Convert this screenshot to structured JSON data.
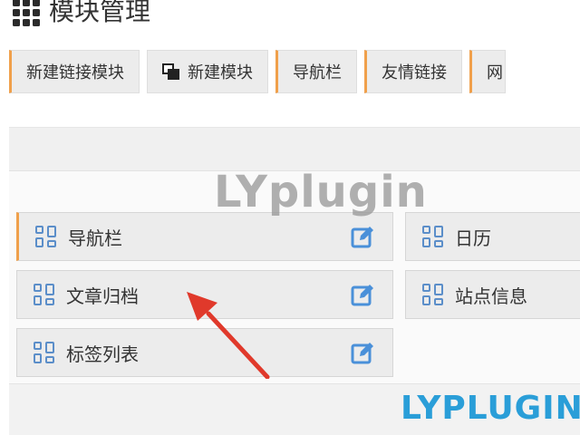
{
  "header": {
    "title": "模块管理",
    "icon": "grid-icon"
  },
  "toolbar": {
    "buttons": [
      {
        "label": "新建链接模块"
      },
      {
        "label": "新建模块",
        "icon": "copy-icon"
      },
      {
        "label": "导航栏"
      },
      {
        "label": "友情链接"
      },
      {
        "label": "网"
      }
    ]
  },
  "modules": {
    "items": [
      {
        "label": "导航栏"
      },
      {
        "label": "日历"
      },
      {
        "label": "文章归档"
      },
      {
        "label": "站点信息"
      },
      {
        "label": "标签列表"
      }
    ]
  },
  "watermarks": {
    "top": "LYplugin",
    "bottom": "LYPLUGIN"
  },
  "colors": {
    "accent": "#f0a04b",
    "icon_blue": "#5b8ec9",
    "edit_blue": "#4a90d9",
    "arrow_red": "#e0392b",
    "watermark_blue": "#2a9ed8"
  }
}
